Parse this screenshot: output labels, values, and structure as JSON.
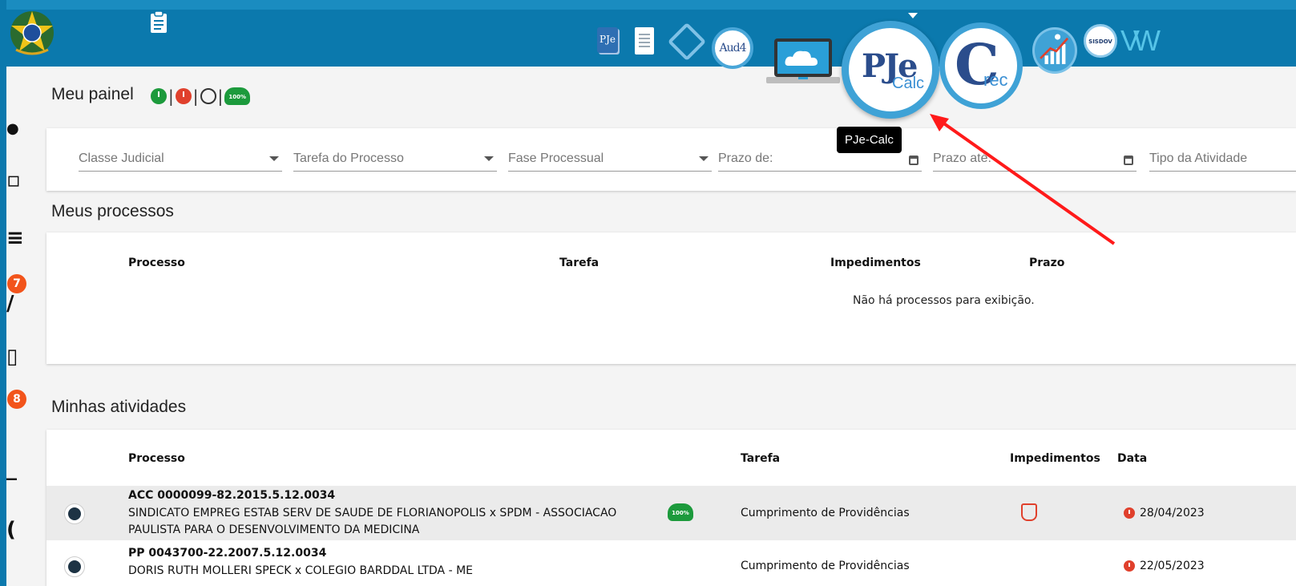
{
  "header": {
    "icons": [
      {
        "name": "brasao-emblem-icon"
      },
      {
        "name": "clipboard-icon"
      },
      {
        "name": "pje-icon",
        "label": "PJe"
      },
      {
        "name": "document-icon"
      },
      {
        "name": "diamond-link-icon"
      },
      {
        "name": "aud4-icon",
        "label": "Aud4"
      },
      {
        "name": "cloud-laptop-icon"
      },
      {
        "name": "pjecalc-icon",
        "label_main": "PJe",
        "label_sub": "Calc"
      },
      {
        "name": "cprec-icon",
        "label_main": "C",
        "label_sub": "rec"
      },
      {
        "name": "runner-chart-icon"
      },
      {
        "name": "sisdov-icon",
        "label": "SISDOV"
      },
      {
        "name": "vw-icon",
        "label": "VW"
      }
    ],
    "tooltip": "PJe-Calc"
  },
  "sidebar": {
    "badges": [
      "7",
      "8"
    ]
  },
  "page": {
    "title": "Meu painel",
    "status_sep": "|",
    "cloud_badge": "100%"
  },
  "filters": {
    "classe": "Classe Judicial",
    "tarefa": "Tarefa do Processo",
    "fase": "Fase Processual",
    "prazo_de": "Prazo de:",
    "prazo_ate": "Prazo até:",
    "tipo": "Tipo da Atividade"
  },
  "meus_processos": {
    "title": "Meus processos",
    "columns": [
      "Processo",
      "Tarefa",
      "Impedimentos",
      "Prazo"
    ],
    "empty_message": "Não há processos para exibição."
  },
  "minhas_atividades": {
    "title": "Minhas atividades",
    "columns": [
      "Processo",
      "Tarefa",
      "Impedimentos",
      "Data"
    ],
    "rows": [
      {
        "numero": "ACC 0000099-82.2015.5.12.0034",
        "partes": "SINDICATO EMPREG ESTAB SERV DE SAUDE DE FLORIANOPOLIS x SPDM - ASSOCIACAO PAULISTA PARA O DESENVOLVIMENTO DA MEDICINA",
        "badge": "100%",
        "tarefa": "Cumprimento de Providências",
        "data": "28/04/2023"
      },
      {
        "numero": "PP 0043700-22.2007.5.12.0034",
        "partes": "DORIS RUTH MOLLERI SPECK x COLEGIO BARDDAL LTDA - ME",
        "tarefa": "Cumprimento de Providências",
        "data": "22/05/2023"
      }
    ]
  },
  "colors": {
    "header_blue": "#0b79ad",
    "accent_light_blue": "#3fa2d6",
    "status_green": "#1c9a3c",
    "status_red": "#e0402c",
    "badge_orange": "#f2541b",
    "annotation_arrow": "#ff1a1a"
  }
}
